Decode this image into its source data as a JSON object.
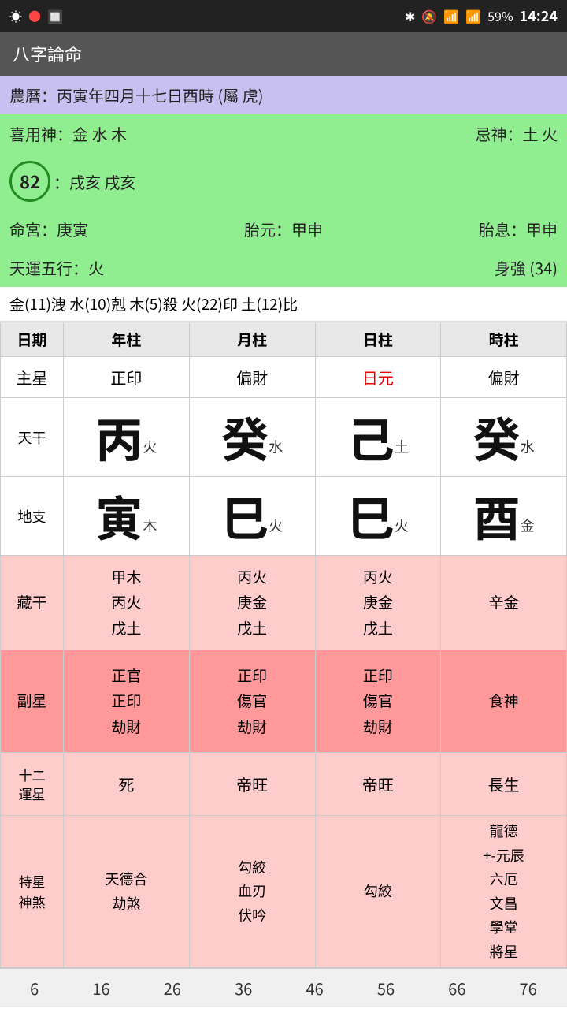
{
  "statusBar": {
    "time": "14:24",
    "battery": "59%"
  },
  "titleBar": {
    "title": "八字論命"
  },
  "infoRows": {
    "lunar": "農曆：丙寅年四月十七日酉時 (屬 虎)",
    "favorable": "喜用神：金 水 木",
    "unfavorable": "忌神：土 火",
    "score": "82",
    "nayin": "：戌亥 戌亥",
    "mingGong": "命宮：庚寅",
    "taiYuan": "胎元：甲申",
    "taiXi": "胎息：甲申",
    "tianYun": "天運五行：火",
    "shenQiang": "身強 (34)",
    "fiveElem": "金(11)洩  水(10)剋  木(5)殺  火(22)印  土(12)比"
  },
  "table": {
    "headers": [
      "日期",
      "年柱",
      "月柱",
      "日柱",
      "時柱"
    ],
    "colLabel": "col",
    "rows": {
      "zhuxing": {
        "label": "主星",
        "nian": "正印",
        "yue": "偏財",
        "ri": "日元",
        "shi": "偏財",
        "riIsRed": true
      },
      "tiangan": {
        "label": "天干",
        "nian": {
          "char": "丙",
          "sub": "火"
        },
        "yue": {
          "char": "癸",
          "sub": "水"
        },
        "ri": {
          "char": "己",
          "sub": "土"
        },
        "shi": {
          "char": "癸",
          "sub": "水"
        }
      },
      "dizhi": {
        "label": "地支",
        "nian": {
          "char": "寅",
          "sub": "木"
        },
        "yue": {
          "char": "巳",
          "sub": "火"
        },
        "ri": {
          "char": "巳",
          "sub": "火"
        },
        "shi": {
          "char": "酉",
          "sub": "金"
        }
      },
      "canggan": {
        "label": "藏干",
        "nian": "甲木\n丙火\n戊土",
        "yue": "丙火\n庚金\n戊土",
        "ri": "丙火\n庚金\n戊土",
        "shi": "辛金"
      },
      "fuxing": {
        "label": "副星",
        "nian": "正官\n正印\n劫財",
        "yue": "正印\n傷官\n劫財",
        "ri": "正印\n傷官\n劫財",
        "shi": "食神"
      },
      "twelvestar": {
        "label": "十二\n運星",
        "nian": "死",
        "yue": "帝旺",
        "ri": "帝旺",
        "shi": "長生"
      },
      "specialstar": {
        "label": "特星\n神煞",
        "nian": "天德合\n劫煞",
        "yue": "勾絞\n血刃\n伏吟",
        "ri": "勾絞",
        "shi": "龍德\n+-元辰\n六厄\n文昌\n學堂\n將星"
      }
    }
  },
  "bottomNumbers": [
    "6",
    "16",
    "26",
    "36",
    "46",
    "56",
    "66",
    "76"
  ]
}
